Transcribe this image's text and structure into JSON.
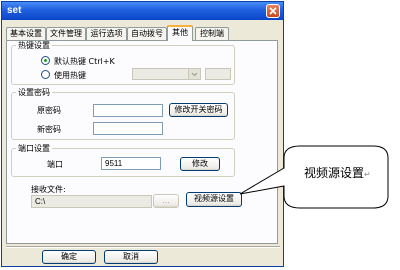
{
  "window": {
    "title": "set"
  },
  "tabs": [
    {
      "label": "基本设置"
    },
    {
      "label": "文件管理"
    },
    {
      "label": "运行选项"
    },
    {
      "label": "自动拨号"
    },
    {
      "label": "其他",
      "active": true
    },
    {
      "label": "控制端"
    }
  ],
  "hotkey": {
    "group_label": "热键设置",
    "default_option": "默认热键 Ctrl+K",
    "custom_option": "使用热键",
    "selected": "default"
  },
  "password": {
    "group_label": "设置密码",
    "original_label": "原密码",
    "original_value": "",
    "new_label": "新密码",
    "new_value": "",
    "modify_button": "修改开关密码"
  },
  "port": {
    "group_label": "端口设置",
    "port_label": "端口",
    "port_value": "9511",
    "modify_button": "修改"
  },
  "receive": {
    "label": "接收文件:",
    "path_value": "C:\\",
    "browse_button": "...",
    "video_source_button": "视频源设置"
  },
  "footer": {
    "ok_button": "确定",
    "cancel_button": "取消"
  },
  "callout": {
    "text": "视频源设置",
    "mark": "↵"
  }
}
